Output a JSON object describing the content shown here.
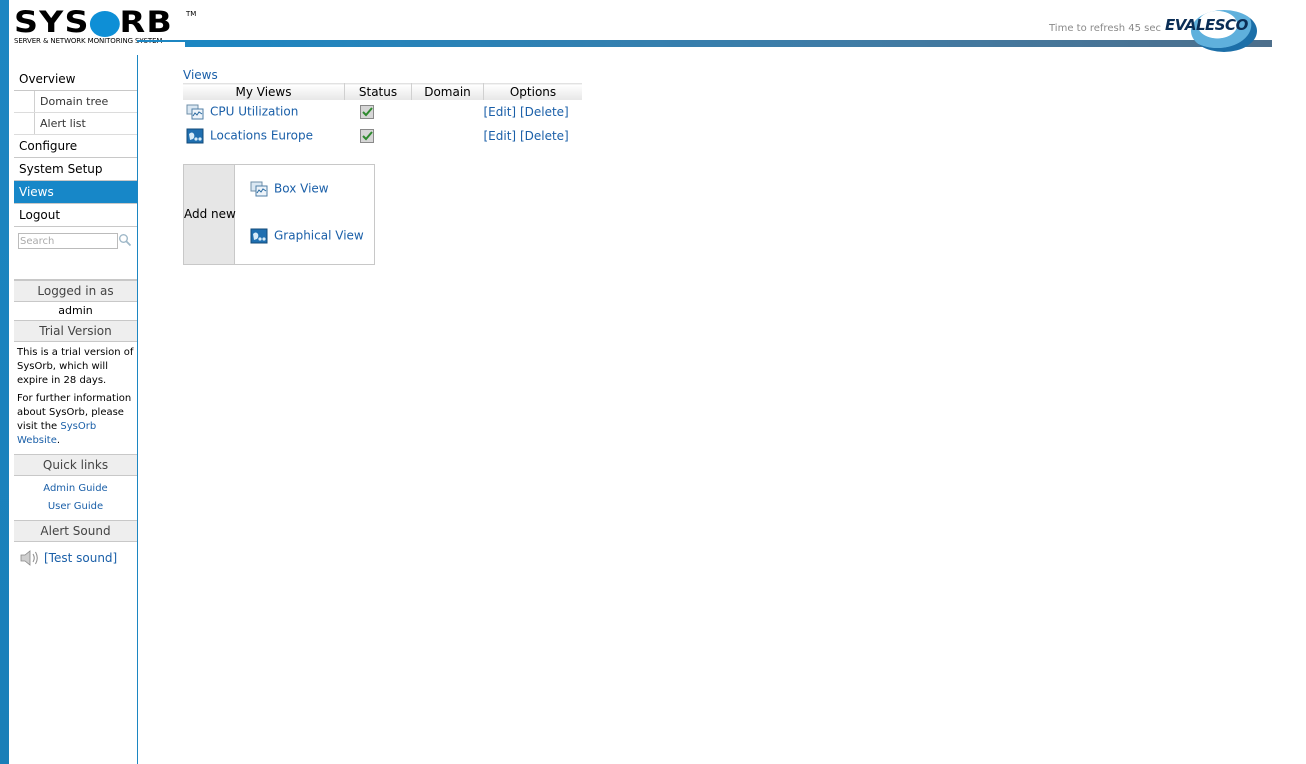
{
  "header": {
    "brand": "SYSORB",
    "trademark": "TM",
    "tagline": "SERVER & NETWORK MONITORING SYSTEM",
    "refresh_text": "Time to refresh 45 sec",
    "partner_logo": "EVALESCO",
    "accent_color": "#1c86c2"
  },
  "sidebar": {
    "nav": [
      {
        "label": "Overview"
      },
      {
        "label": "Domain tree",
        "sub": true
      },
      {
        "label": "Alert list",
        "sub": true
      },
      {
        "label": "Configure"
      },
      {
        "label": "System Setup"
      },
      {
        "label": "Views",
        "active": true
      },
      {
        "label": "Logout"
      }
    ],
    "search": {
      "placeholder": "Search",
      "icon": "magnifier-icon"
    },
    "logged_in": {
      "heading": "Logged in as",
      "user": "admin"
    },
    "trial": {
      "heading": "Trial Version",
      "text1": "This is a trial version of SysOrb, which will expire in 28 days.",
      "text2_prefix": "For further information about SysOrb, please visit the ",
      "link": "SysOrb Website",
      "text2_suffix": "."
    },
    "quick_links": {
      "heading": "Quick links",
      "links": [
        "Admin Guide",
        "User Guide"
      ]
    },
    "alert_sound": {
      "heading": "Alert Sound",
      "icon": "speaker-icon",
      "link": "[Test sound]"
    }
  },
  "main": {
    "title": "Views",
    "table": {
      "headers": [
        "My Views",
        "Status",
        "Domain",
        "Options"
      ],
      "rows": [
        {
          "name": "CPU Utilization",
          "icon": "box-view-icon",
          "status": "checked",
          "domain": "",
          "edit": "[Edit]",
          "delete": "[Delete]"
        },
        {
          "name": "Locations Europe",
          "icon": "graphical-view-icon",
          "status": "checked",
          "domain": "",
          "edit": "[Edit]",
          "delete": "[Delete]"
        }
      ]
    },
    "add_new": {
      "label": "Add new",
      "options": [
        {
          "label": "Box View",
          "icon": "box-view-icon"
        },
        {
          "label": "Graphical View",
          "icon": "graphical-view-icon"
        }
      ]
    }
  }
}
